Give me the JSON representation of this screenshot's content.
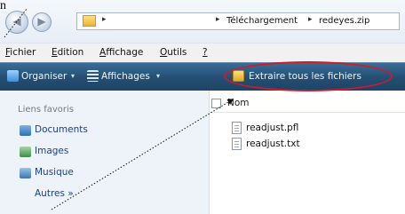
{
  "address_bar": {
    "back_arrow": "◀",
    "forward_arrow": "▶",
    "sep1": "▸",
    "sep2": "▸",
    "sep3": "▸",
    "crumbs": [
      "Téléchargement",
      "redeyes.zip"
    ]
  },
  "menu": {
    "items": [
      {
        "first": "F",
        "rest": "ichier"
      },
      {
        "first": "E",
        "rest": "dition"
      },
      {
        "first": "A",
        "rest": "ffichage"
      },
      {
        "first": "O",
        "rest": "utils"
      },
      {
        "first": "?",
        "rest": ""
      }
    ]
  },
  "toolbar": {
    "organize_label": "Organiser",
    "views_label": "Affichages",
    "dropdown_arrow": "▾",
    "extract_label": "Extraire tous les fichiers"
  },
  "navpane": {
    "heading": "Liens favoris",
    "items": [
      {
        "label": "Documents"
      },
      {
        "label": "Images"
      },
      {
        "label": "Musique"
      },
      {
        "label": "Autres »"
      }
    ]
  },
  "filepane": {
    "column_name": "Nom",
    "files": [
      "readjust.pfl",
      "readjust.txt"
    ]
  },
  "annotation": {
    "corner_letter": "n",
    "colors": {
      "ellipse": "#d11a2a",
      "arrow": "#111111"
    }
  }
}
